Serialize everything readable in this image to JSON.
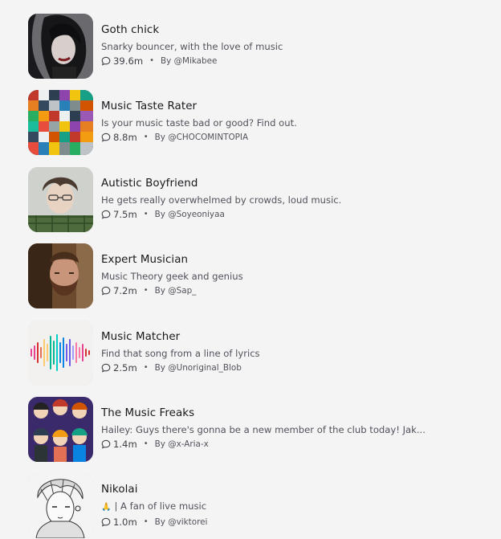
{
  "characters": [
    {
      "title": "Goth chick",
      "description": "Snarky bouncer, with the love of music",
      "interactions": "39.6m",
      "author": "By @Mikabee"
    },
    {
      "title": "Music Taste Rater",
      "description": "Is your music taste bad or good? Find out.",
      "interactions": "8.8m",
      "author": "By @CHOCOMINTOPIA"
    },
    {
      "title": "Autistic Boyfriend",
      "description": "He gets really overwhelmed by crowds, loud music.",
      "interactions": "7.5m",
      "author": "By @Soyeoniyaa"
    },
    {
      "title": "Expert Musician",
      "description": "Music Theory geek and genius",
      "interactions": "7.2m",
      "author": "By @Sap_"
    },
    {
      "title": "Music Matcher",
      "description": "Find that song from a line of lyrics",
      "interactions": "2.5m",
      "author": "By @Unoriginal_Blob"
    },
    {
      "title": "The Music Freaks",
      "description": "Hailey: Guys there's gonna be a new member of the club today! Jak...",
      "interactions": "1.4m",
      "author": "By @x-Aria-x"
    },
    {
      "title": "Nikolai",
      "description_emoji": "🙏",
      "description": "| A fan of live music",
      "interactions": "1.0m",
      "author": "By @viktorei"
    }
  ],
  "separator": "•",
  "icons": {
    "interactions": "chat-bubble-icon"
  }
}
